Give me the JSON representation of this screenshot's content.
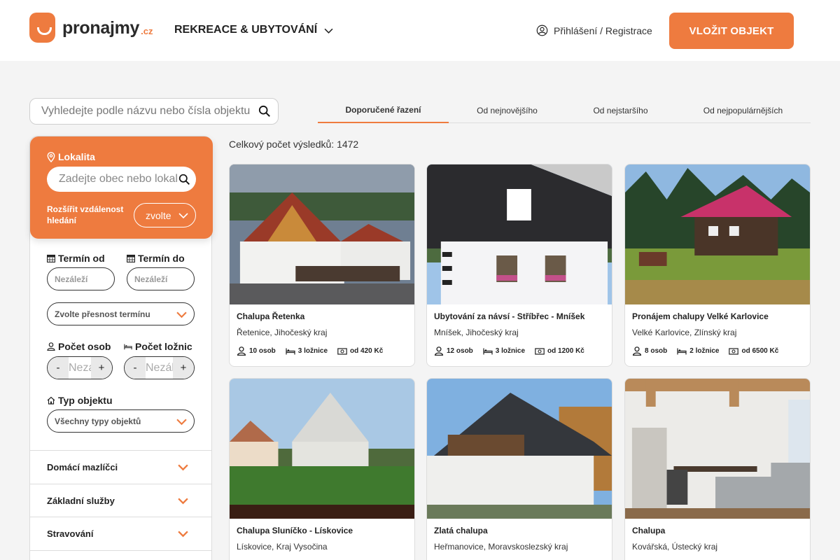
{
  "brand": {
    "name": "pronajmy",
    "tld": ".cz",
    "accent": "#ee7b3f"
  },
  "header": {
    "category": "REKREACE & UBYTOVÁNÍ",
    "login": "Přihlášení / Registrace",
    "add_button": "VLOŽIT OBJEKT"
  },
  "search": {
    "placeholder": "Vyhledejte podle názvu nebo čísla objektu"
  },
  "sort_tabs": [
    {
      "label": "Doporučené řazení",
      "active": true
    },
    {
      "label": "Od nejnovějšího",
      "active": false
    },
    {
      "label": "Od nejstaršího",
      "active": false
    },
    {
      "label": "Od nejpopulárnějších",
      "active": false
    }
  ],
  "results": {
    "text": "Celkový počet výsledků: 1472"
  },
  "filters": {
    "location_label": "Lokalita",
    "location_placeholder": "Zadejte obec nebo lokalitu",
    "distance_label": "Rozšířit vzdálenost hledání",
    "distance_value": "zvolte",
    "date_from_label": "Termín od",
    "date_to_label": "Termín do",
    "date_from_value": "Nezáleží",
    "date_to_value": "Nezáleží",
    "precision": "Zvolte přesnost termínu",
    "persons_label": "Počet osob",
    "bedrooms_label": "Počet ložnic",
    "persons_value": "Nezáleží",
    "bedrooms_value": "Nezáleží",
    "minus": "-",
    "plus": "+",
    "type_label": "Typ objektu",
    "type_value": "Všechny typy objektů",
    "accordions": [
      "Domácí mazlíčci",
      "Základní služby",
      "Stravování"
    ]
  },
  "listings": [
    {
      "title": "Chalupa Řetenka",
      "place": "Řetenice, Jihočeský kraj",
      "persons": "10 osob",
      "bedrooms": "3 ložnice",
      "price": "od 420 Kč"
    },
    {
      "title": "Ubytování za návsí - Stříbřec - Mníšek",
      "place": "Mníšek, Jihočeský kraj",
      "persons": "12 osob",
      "bedrooms": "3 ložnice",
      "price": "od 1200 Kč"
    },
    {
      "title": "Pronájem chalupy Velké Karlovice",
      "place": "Velké Karlovice, Zlínský kraj",
      "persons": "8 osob",
      "bedrooms": "2 ložnice",
      "price": "od 6500 Kč"
    },
    {
      "title": "Chalupa Sluníčko - Lískovice",
      "place": "Lískovice, Kraj Vysočina"
    },
    {
      "title": "Zlatá chalupa",
      "place": "Heřmanovice, Moravskoslezský kraj"
    },
    {
      "title": "Chalupa",
      "place": "Kovářská, Ústecký kraj"
    }
  ]
}
